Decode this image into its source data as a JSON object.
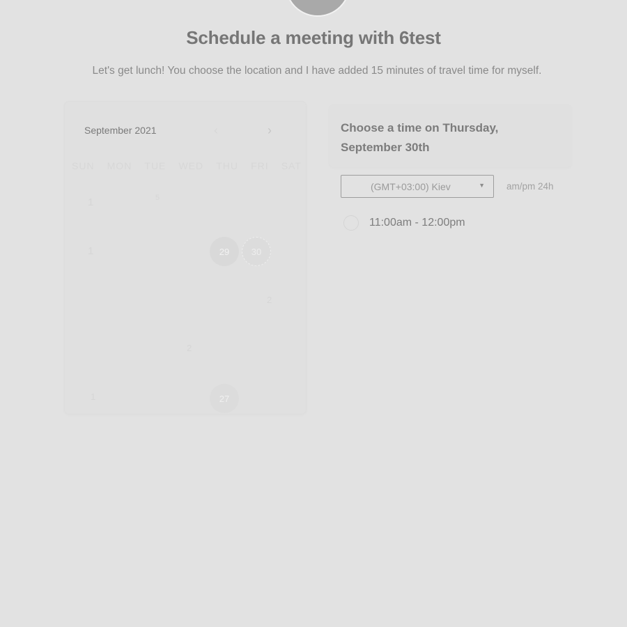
{
  "header": {
    "title": "Schedule a meeting with 6test",
    "subtitle": "Let's get lunch! You choose the location and I have added 15 minutes of travel time for myself."
  },
  "calendar": {
    "month_label": "September 2021",
    "prev_icon": "chevron-left-icon",
    "next_icon": "chevron-right-icon",
    "weekdays": [
      "SUN",
      "MON",
      "TUE",
      "WED",
      "THU",
      "FRI",
      "SAT"
    ],
    "visible_days": [
      {
        "label": "1"
      },
      {
        "label": "5"
      },
      {
        "label": "1"
      },
      {
        "label": "29"
      },
      {
        "label": "30"
      },
      {
        "label": "2"
      },
      {
        "label": "2"
      },
      {
        "label": "1"
      },
      {
        "label": "27"
      }
    ],
    "selected_day": "30"
  },
  "time_panel": {
    "title": "Choose a time on Thursday, September 30th",
    "timezone": "(GMT+03:00) Kiev",
    "format_toggle": "am/pm  24h",
    "slots": [
      {
        "label": "11:00am - 12:00pm"
      }
    ]
  },
  "colors": {
    "background": "#e2e2e2",
    "text": "#777777"
  }
}
